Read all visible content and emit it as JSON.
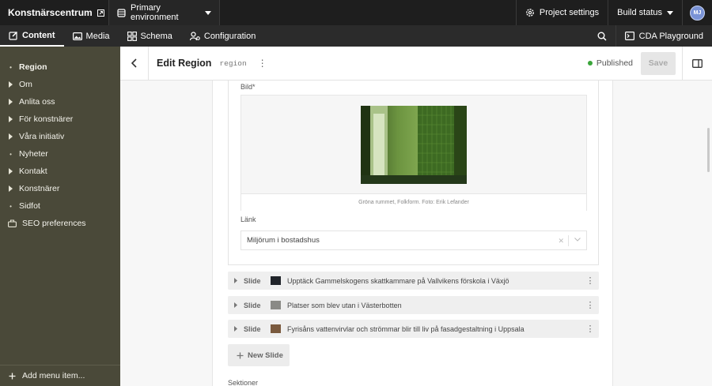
{
  "topbar": {
    "brand": "Konstnärscentrum",
    "environment": "Primary environment",
    "project_settings": "Project settings",
    "build_status": "Build status",
    "avatar_initials": "MJ"
  },
  "navbar": {
    "tabs": [
      {
        "label": "Content",
        "icon": "pencil-square-icon",
        "active": true
      },
      {
        "label": "Media",
        "icon": "image-icon",
        "active": false
      },
      {
        "label": "Schema",
        "icon": "schema-icon",
        "active": false
      },
      {
        "label": "Configuration",
        "icon": "configuration-icon",
        "active": false
      }
    ],
    "cda_label": "CDA Playground"
  },
  "sidebar": {
    "items": [
      {
        "label": "Region",
        "marker": "bullet",
        "active": true
      },
      {
        "label": "Om",
        "marker": "triangle"
      },
      {
        "label": "Anlita oss",
        "marker": "triangle"
      },
      {
        "label": "För konstnärer",
        "marker": "triangle"
      },
      {
        "label": "Våra initiativ",
        "marker": "triangle"
      },
      {
        "label": "Nyheter",
        "marker": "bullet"
      },
      {
        "label": "Kontakt",
        "marker": "triangle"
      },
      {
        "label": "Konstnärer",
        "marker": "triangle"
      },
      {
        "label": "Sidfot",
        "marker": "bullet"
      },
      {
        "label": "SEO preferences",
        "marker": "seo"
      }
    ],
    "add_menu_item": "Add menu item..."
  },
  "header": {
    "title": "Edit Region",
    "model": "region",
    "status": "Published",
    "save_label": "Save"
  },
  "form": {
    "image_label": "Bild*",
    "image_caption": "Gröna rummet, Folkform. Foto: Erik Lefander",
    "link_label": "Länk",
    "link_value": "Miljörum i bostadshus",
    "slides": [
      {
        "kind": "Slide",
        "title": "Upptäck Gammelskogens skattkammare på Vallvikens förskola i Växjö"
      },
      {
        "kind": "Slide",
        "title": "Platser som blev utan i Västerbotten"
      },
      {
        "kind": "Slide",
        "title": "Fyrisåns vattenvirvlar och strömmar blir till liv på fasadgestaltning i Uppsala"
      }
    ],
    "new_slide": "New Slide",
    "sections_label": "Sektioner"
  },
  "colors": {
    "sidebar_bg": "#4a4939",
    "topbar_bg": "#1e1e1e",
    "published": "#3aa53a"
  }
}
